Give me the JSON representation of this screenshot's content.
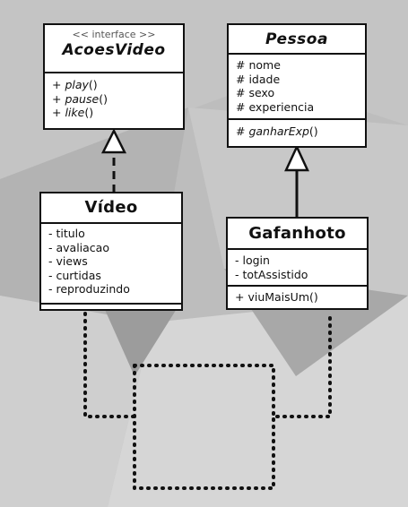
{
  "diagram": {
    "interface_box": {
      "stereotype": "<< interface >>",
      "name": "AcoesVideo",
      "methods": [
        {
          "prefix": "+ ",
          "name": "play",
          "suffix": "()"
        },
        {
          "prefix": "+ ",
          "name": "pause",
          "suffix": "()"
        },
        {
          "prefix": "+ ",
          "name": "like",
          "suffix": "()"
        }
      ]
    },
    "pessoa_box": {
      "name": "Pessoa",
      "attributes": [
        "# nome",
        "# idade",
        "# sexo",
        "# experiencia"
      ],
      "methods": [
        {
          "prefix": "# ",
          "name": "ganharExp",
          "suffix": "()"
        }
      ]
    },
    "video_box": {
      "name": "Vídeo",
      "attributes": [
        "- titulo",
        "- avaliacao",
        "- views",
        "- curtidas",
        "- reproduzindo"
      ]
    },
    "gafanhoto_box": {
      "name": "Gafanhoto",
      "attributes": [
        "- login",
        "- totAssistido"
      ],
      "methods": [
        "+ viuMaisUm()"
      ]
    }
  }
}
